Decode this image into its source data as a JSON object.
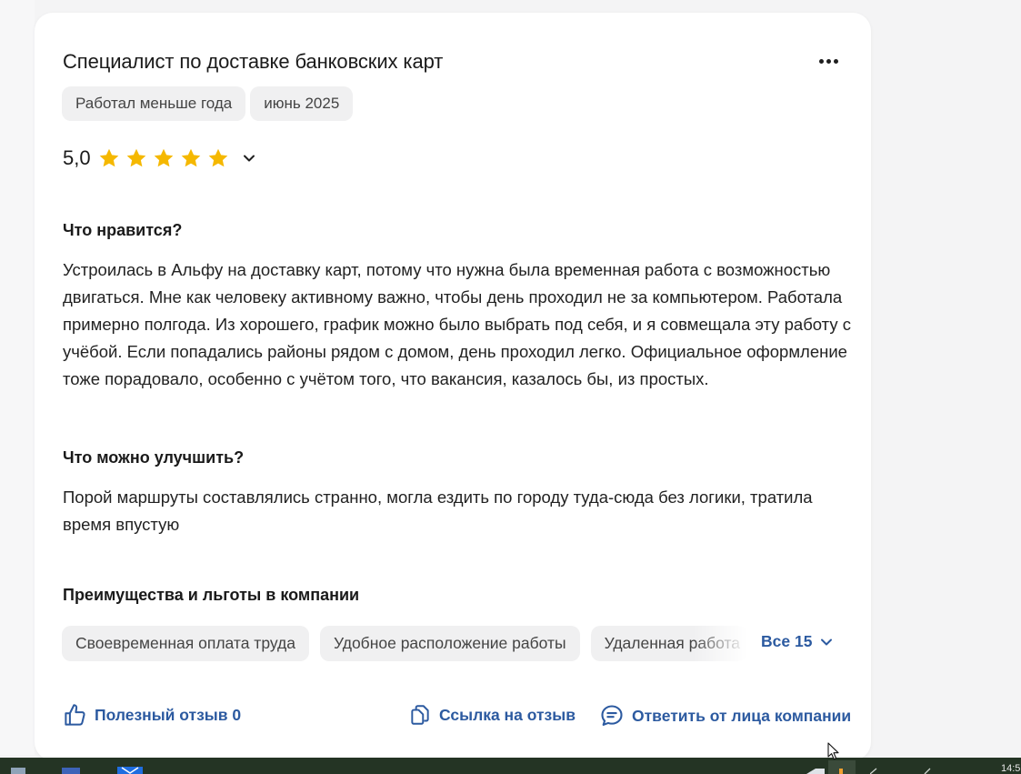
{
  "review": {
    "title": "Специалист по доставке банковских карт",
    "tags": [
      "Работал меньше года",
      "июнь 2025"
    ],
    "rating": "5,0",
    "rating_stars": 5,
    "likes_heading": "Что нравится?",
    "likes_text": "Устроилась в Альфу на доставку карт, потому что нужна была временная работа с возможностью двигаться. Мне как человеку активному важно, чтобы день проходил не за компьютером. Работала примерно полгода. Из хорошего, график можно было выбрать под себя, и я совмещала эту работу с учёбой. Если попадались районы рядом с домом, день проходил легко. Официальное оформление тоже порадовало, особенно с учётом того, что вакансия, казалось бы, из простых.",
    "improve_heading": "Что можно улучшить?",
    "improve_text": "Порой маршруты составлялись странно, могла ездить по городу туда-сюда без логики, тратила время впустую",
    "benefits_heading": "Преимущества и льготы в компании",
    "benefits": [
      "Своевременная оплата труда",
      "Удобное расположение работы",
      "Удаленная работа"
    ],
    "benefits_all": "Все 15"
  },
  "footer": {
    "helpful": "Полезный отзыв 0",
    "link": "Ссылка на отзыв",
    "reply": "Ответить от лица компании"
  },
  "taskbar": {
    "clock": "14:5"
  },
  "colors": {
    "accent": "#2c5aa0",
    "star": "#f5b800",
    "chip": "#f0f0f1"
  },
  "icons": [
    "more-horizontal-icon",
    "star-icon",
    "chevron-down-icon",
    "thumbs-up-icon",
    "copy-link-icon",
    "chat-icon"
  ]
}
